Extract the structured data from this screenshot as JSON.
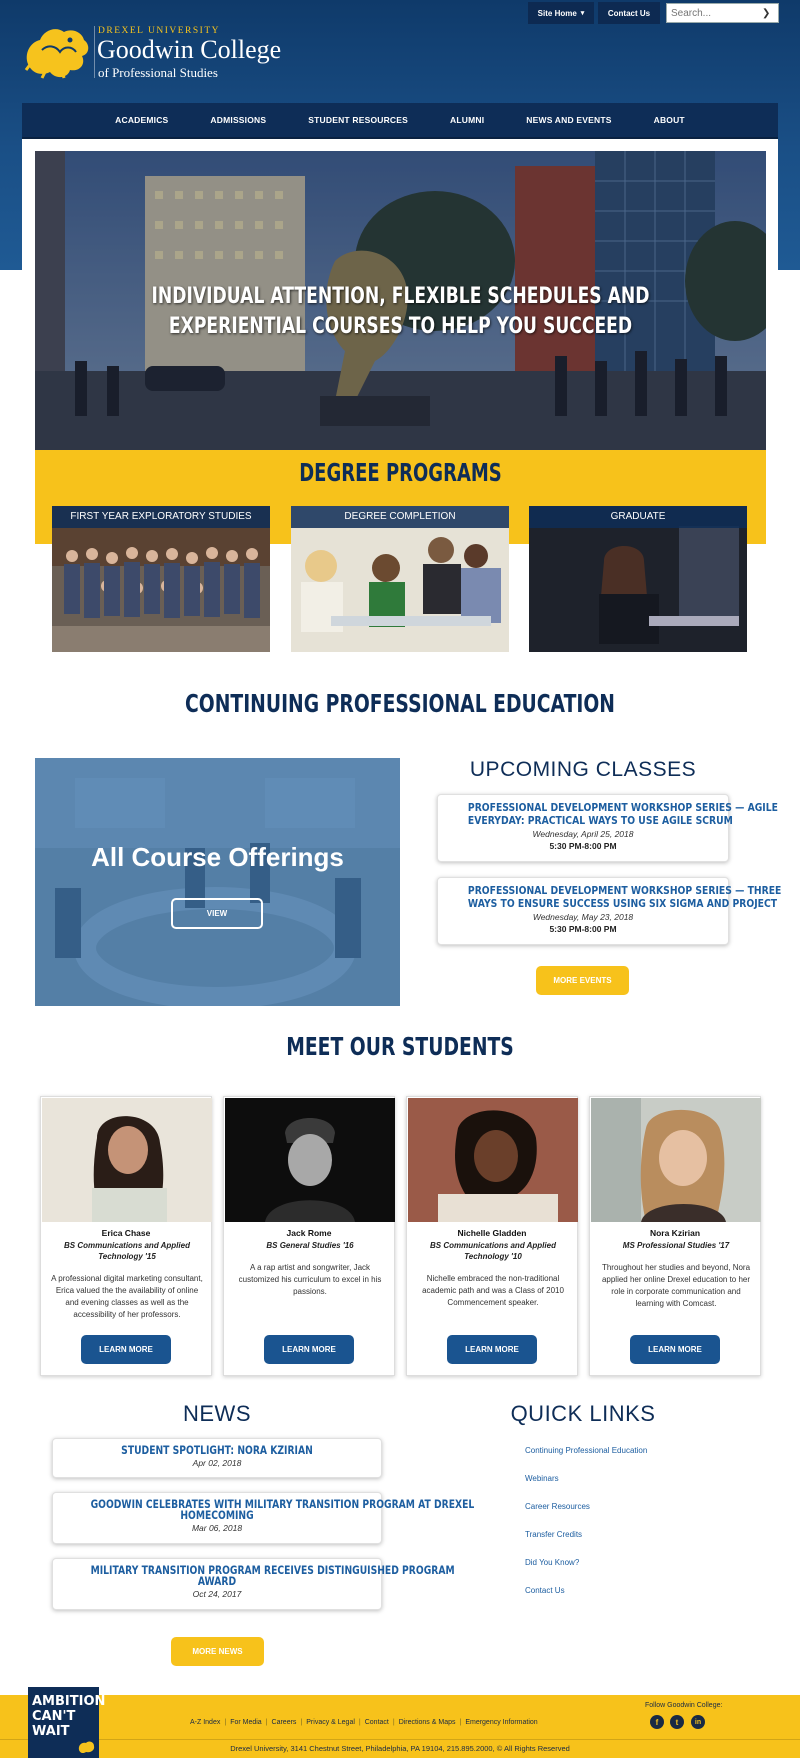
{
  "header": {
    "university": "DREXEL UNIVERSITY",
    "college": "Goodwin College",
    "subtitle": "of Professional Studies",
    "site_home": "Site Home",
    "contact": "Contact Us",
    "search_placeholder": "Search..."
  },
  "nav": [
    "ACADEMICS",
    "ADMISSIONS",
    "STUDENT RESOURCES",
    "ALUMNI",
    "NEWS AND EVENTS",
    "ABOUT"
  ],
  "hero": {
    "line1": "INDIVIDUAL ATTENTION, FLEXIBLE SCHEDULES AND",
    "line2": "EXPERIENTIAL COURSES TO HELP YOU SUCCEED"
  },
  "degree": {
    "title": "DEGREE PROGRAMS",
    "cards": [
      "FIRST YEAR EXPLORATORY STUDIES",
      "DEGREE COMPLETION",
      "GRADUATE"
    ]
  },
  "cpe": {
    "title": "CONTINUING PROFESSIONAL EDUCATION",
    "offerings": "All Course Offerings",
    "view": "VIEW"
  },
  "upcoming": {
    "title": "UPCOMING CLASSES",
    "events": [
      {
        "l1": "PROFESSIONAL DEVELOPMENT WORKSHOP SERIES — AGILE",
        "l2": "EVERYDAY: PRACTICAL WAYS TO USE AGILE SCRUM",
        "date": "Wednesday, April 25, 2018",
        "time": "5:30 PM-8:00 PM"
      },
      {
        "l1": "PROFESSIONAL DEVELOPMENT WORKSHOP SERIES — THREE",
        "l2": "WAYS TO ENSURE SUCCESS USING SIX SIGMA AND PROJECT",
        "date": "Wednesday, May 23, 2018",
        "time": "5:30 PM-8:00 PM"
      }
    ],
    "more": "MORE EVENTS"
  },
  "students": {
    "title": "MEET OUR STUDENTS",
    "learn_more": "LEARN MORE",
    "items": [
      {
        "name": "Erica Chase",
        "degree": "BS Communications and Applied Technology '15",
        "bio": "A professional digital marketing consultant, Erica valued the the availability of online and evening classes as well as the accessibility of her professors."
      },
      {
        "name": "Jack Rome",
        "degree": "BS General Studies '16",
        "bio": "A a rap artist and songwriter, Jack customized his curriculum to excel in his passions."
      },
      {
        "name": "Nichelle Gladden",
        "degree": "BS Communications and Applied Technology '10",
        "bio": "Nichelle embraced the non-traditional academic path and was a Class of 2010 Commencement speaker."
      },
      {
        "name": "Nora Kzirian",
        "degree": "MS Professional Studies '17",
        "bio": "Throughout her studies and beyond, Nora applied her online Drexel education to her role in corporate communication and learning with Comcast."
      }
    ]
  },
  "news": {
    "title": "NEWS",
    "items": [
      {
        "l1": "STUDENT SPOTLIGHT: NORA KZIRIAN",
        "l2": "",
        "date": "Apr 02, 2018"
      },
      {
        "l1": "GOODWIN CELEBRATES WITH MILITARY TRANSITION PROGRAM AT DREXEL",
        "l2": "HOMECOMING",
        "date": "Mar 06, 2018"
      },
      {
        "l1": "MILITARY TRANSITION PROGRAM RECEIVES DISTINGUISHED PROGRAM",
        "l2": "AWARD",
        "date": "Oct 24, 2017"
      }
    ],
    "more": "MORE NEWS"
  },
  "quicklinks": {
    "title": "QUICK LINKS",
    "items": [
      "Continuing Professional Education",
      "Webinars",
      "Career Resources",
      "Transfer Credits",
      "Did You Know?",
      "Contact Us"
    ]
  },
  "footer": {
    "ambition": [
      "AMBITION",
      "CAN'T",
      "WAIT"
    ],
    "links": [
      "A-Z Index",
      "For Media",
      "Careers",
      "Privacy & Legal",
      "Contact",
      "Directions & Maps",
      "Emergency Information"
    ],
    "follow": "Follow Goodwin College:",
    "address": "Drexel University, 3141 Chestnut Street, Philadelphia, PA 19104, 215.895.2000, © All Rights Reserved"
  },
  "colors": {
    "navy": "#0e2d57",
    "gold": "#f7c21b",
    "link_blue": "#1d5ea0",
    "button_blue": "#1a5490"
  }
}
